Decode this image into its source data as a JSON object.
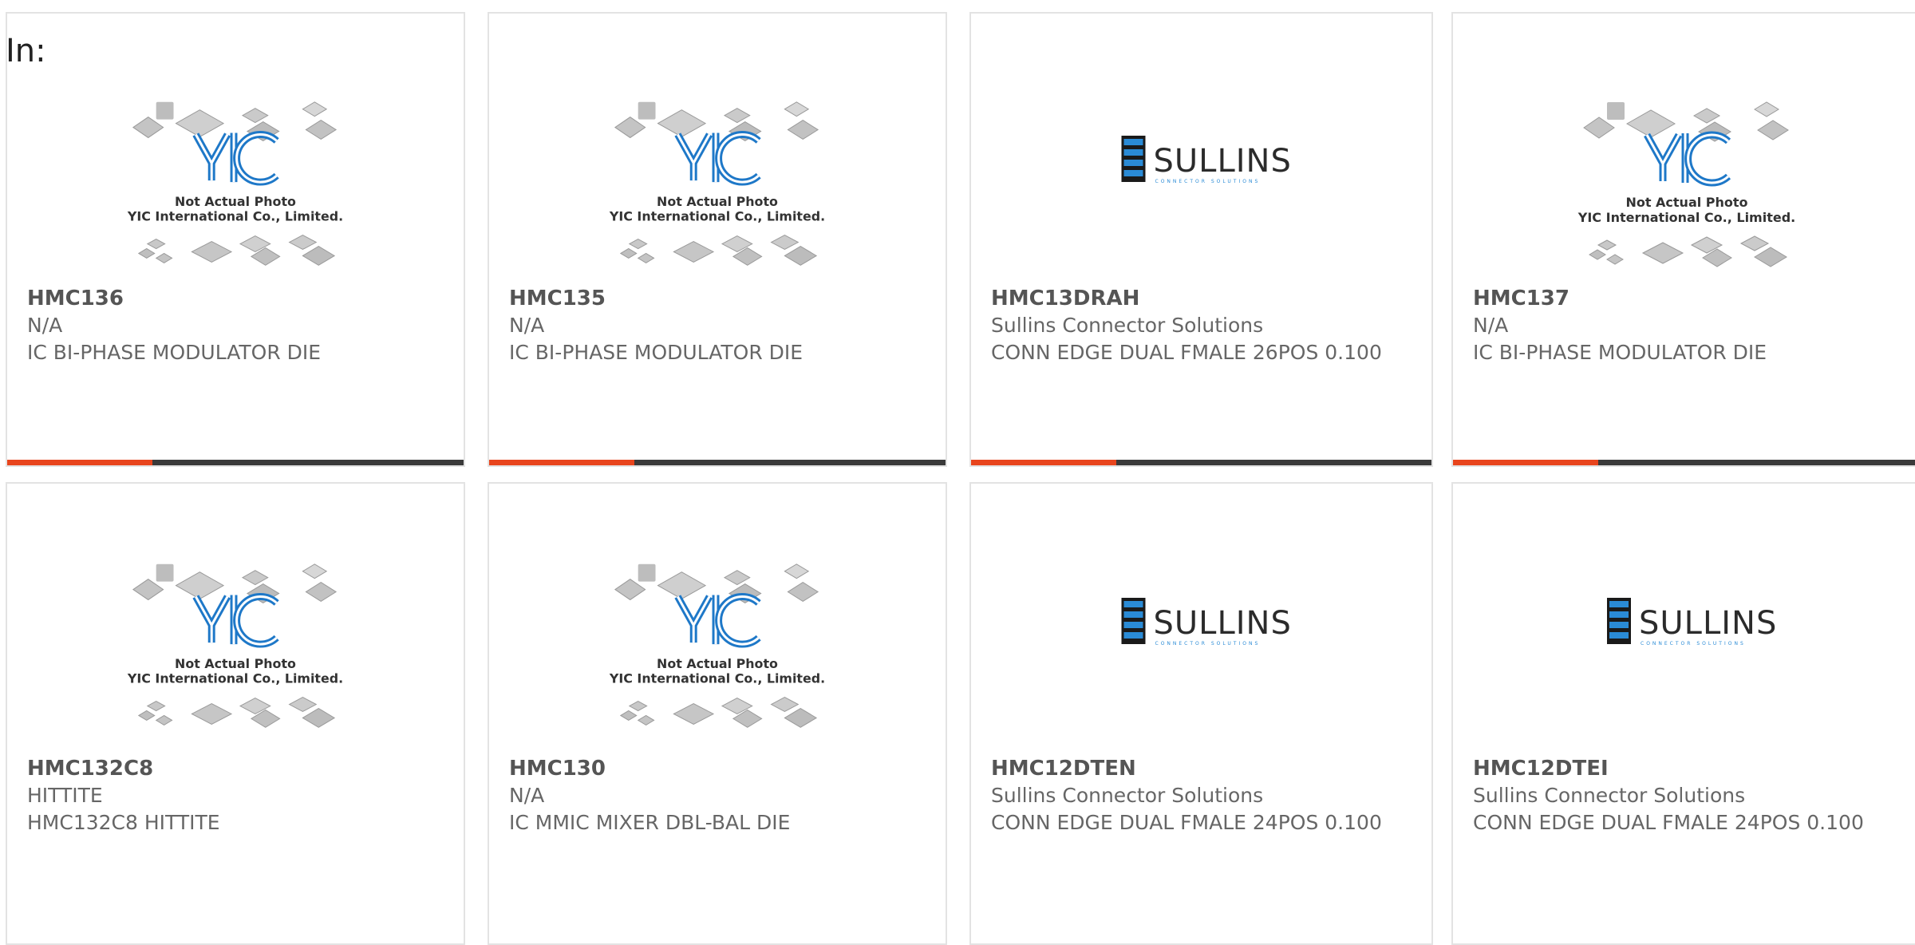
{
  "filter_label": "In:",
  "accent_color": "#e8451d",
  "bar_color": "#3a3a3a",
  "products": [
    {
      "part": "HMC136",
      "maker": "N/A",
      "desc": "IC BI-PHASE MODULATOR DIE",
      "image": "yic",
      "img_caption1": "Not Actual Photo",
      "img_caption2": "YIC International Co., Limited."
    },
    {
      "part": "HMC135",
      "maker": "N/A",
      "desc": "IC BI-PHASE MODULATOR DIE",
      "image": "yic",
      "img_caption1": "Not Actual Photo",
      "img_caption2": "YIC International Co., Limited."
    },
    {
      "part": "HMC13DRAH",
      "maker": "Sullins Connector Solutions",
      "desc": "CONN EDGE DUAL FMALE 26POS 0.100",
      "image": "sullins",
      "logo_text": "SULLINS",
      "logo_sub": "CONNECTOR SOLUTIONS"
    },
    {
      "part": "HMC137",
      "maker": "N/A",
      "desc": "IC BI-PHASE MODULATOR DIE",
      "image": "yic",
      "img_caption1": "Not Actual Photo",
      "img_caption2": "YIC International Co., Limited."
    },
    {
      "part": "HMC132C8",
      "maker": "HITTITE",
      "desc": "HMC132C8 HITTITE",
      "image": "yic",
      "img_caption1": "Not Actual Photo",
      "img_caption2": "YIC International Co., Limited."
    },
    {
      "part": "HMC130",
      "maker": "N/A",
      "desc": "IC MMIC MIXER DBL-BAL DIE",
      "image": "yic",
      "img_caption1": "Not Actual Photo",
      "img_caption2": "YIC International Co., Limited."
    },
    {
      "part": "HMC12DTEN",
      "maker": "Sullins Connector Solutions",
      "desc": "CONN EDGE DUAL FMALE 24POS 0.100",
      "image": "sullins",
      "logo_text": "SULLINS",
      "logo_sub": "CONNECTOR SOLUTIONS"
    },
    {
      "part": "HMC12DTEI",
      "maker": "Sullins Connector Solutions",
      "desc": "CONN EDGE DUAL FMALE 24POS 0.100",
      "image": "sullins",
      "logo_text": "SULLINS",
      "logo_sub": "CONNECTOR SOLUTIONS"
    }
  ]
}
